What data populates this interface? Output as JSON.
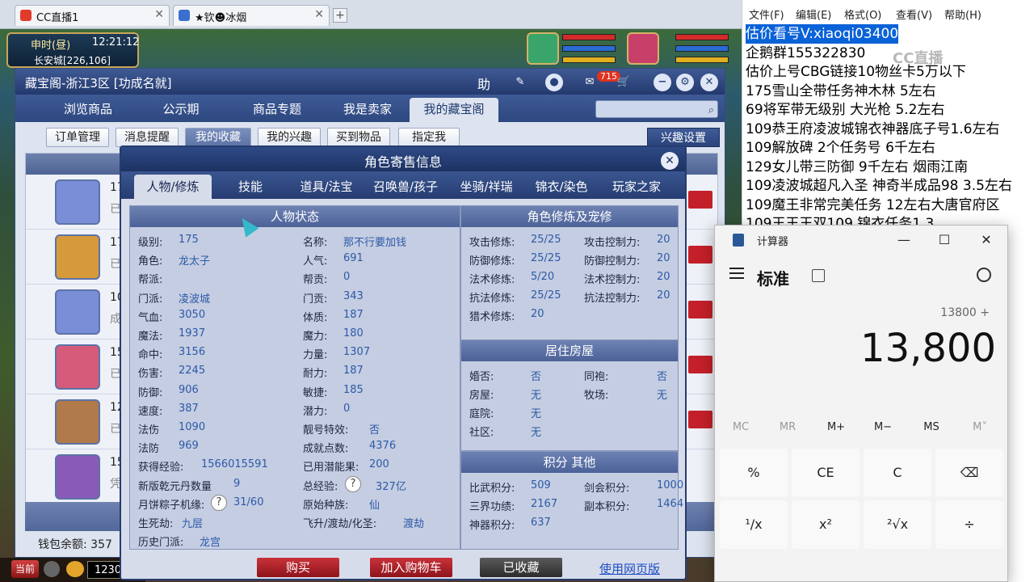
{
  "browser": {
    "tabs": [
      {
        "label": "CC直播1"
      },
      {
        "label": "★钦☻冰烟"
      }
    ],
    "add_tab": "+"
  },
  "game": {
    "time_label": "申时(昼)",
    "time_value": "12:21:12",
    "location": "长安城[226,106]",
    "bottom_left_label": "当前",
    "bottom_number": "1230",
    "colors": {
      "hp": "#d42a2a",
      "mp": "#2a6bd4",
      "sp": "#e0b020"
    }
  },
  "cbg": {
    "title": "藏宝阁-浙江3区 [功成名就]",
    "help_label": "助",
    "cart_count": "715",
    "nav_tabs": [
      "浏览商品",
      "公示期",
      "商品专题",
      "我是卖家",
      "我的藏宝阁"
    ],
    "sub_tabs": [
      "订单管理",
      "消息提醒",
      "我的收藏",
      "我的兴趣",
      "买到物品",
      "指定我"
    ],
    "interest_button": "兴趣设置",
    "list_rows": [
      {
        "level": "17",
        "sub": "已"
      },
      {
        "level": "17",
        "sub": "已"
      },
      {
        "level": "10",
        "sub": "成"
      },
      {
        "level": "15",
        "sub": "已"
      },
      {
        "level": "12",
        "sub": "已"
      },
      {
        "level": "15",
        "sub": "凭"
      }
    ],
    "wallet_label": "钱包余额: 357",
    "accent_color": "#2e4880"
  },
  "modal": {
    "title": "角色寄售信息",
    "close_label": "✕",
    "tabs": [
      "人物/修炼",
      "技能",
      "道具/法宝",
      "召唤兽/孩子",
      "坐骑/祥瑞",
      "锦衣/染色",
      "玩家之家"
    ],
    "status_panel": {
      "title": "人物状态",
      "left": [
        {
          "label": "级别:",
          "value": "175"
        },
        {
          "label": "角色:",
          "value": "龙太子"
        },
        {
          "label": "帮派:",
          "value": ""
        },
        {
          "label": "门派:",
          "value": "凌波城"
        },
        {
          "label": "气血:",
          "value": "3050"
        },
        {
          "label": "魔法:",
          "value": "1937"
        },
        {
          "label": "命中:",
          "value": "3156"
        },
        {
          "label": "伤害:",
          "value": "2245"
        },
        {
          "label": "防御:",
          "value": "906"
        },
        {
          "label": "速度:",
          "value": "387"
        },
        {
          "label": "法伤",
          "value": "1090"
        },
        {
          "label": "法防",
          "value": "969"
        },
        {
          "label": "获得经验:",
          "value": "1566015591"
        },
        {
          "label": "新版乾元丹数量",
          "value": "9"
        },
        {
          "label": "月饼粽子机缘:",
          "value": "31/60"
        },
        {
          "label": "生死劫:",
          "value": "九层"
        },
        {
          "label": "历史门派:",
          "value": "龙宫"
        }
      ],
      "right": [
        {
          "label": "名称:",
          "value": "那不行要加钱"
        },
        {
          "label": "人气:",
          "value": "691"
        },
        {
          "label": "帮贡:",
          "value": "0"
        },
        {
          "label": "门贡:",
          "value": "343"
        },
        {
          "label": "体质:",
          "value": "187"
        },
        {
          "label": "魔力:",
          "value": "180"
        },
        {
          "label": "力量:",
          "value": "1307"
        },
        {
          "label": "耐力:",
          "value": "187"
        },
        {
          "label": "敏捷:",
          "value": "185"
        },
        {
          "label": "潜力:",
          "value": "0"
        },
        {
          "label": "靓号特效:",
          "value": "否"
        },
        {
          "label": "成就点数:",
          "value": "4376"
        },
        {
          "label": "已用潜能果:",
          "value": "200"
        },
        {
          "label": "总经验:",
          "value": "327亿"
        },
        {
          "label": "原始种族:",
          "value": "仙"
        },
        {
          "label": "飞升/渡劫/化圣:",
          "value": "渡劫"
        }
      ]
    },
    "cultivation_panel": {
      "title": "角色修炼及宠修",
      "rows": [
        {
          "l1": "攻击修炼:",
          "v1": "25/25",
          "l2": "攻击控制力:",
          "v2": "20"
        },
        {
          "l1": "防御修炼:",
          "v1": "25/25",
          "l2": "防御控制力:",
          "v2": "20"
        },
        {
          "l1": "法术修炼:",
          "v1": "5/20",
          "l2": "法术控制力:",
          "v2": "20"
        },
        {
          "l1": "抗法修炼:",
          "v1": "25/25",
          "l2": "抗法控制力:",
          "v2": "20"
        },
        {
          "l1": "猎术修炼:",
          "v1": "20",
          "l2": "",
          "v2": ""
        }
      ]
    },
    "house_panel": {
      "title": "居住房屋",
      "rows": [
        {
          "l1": "婚否:",
          "v1": "否",
          "l2": "同袍:",
          "v2": "否"
        },
        {
          "l1": "房屋:",
          "v1": "无",
          "l2": "牧场:",
          "v2": "无"
        },
        {
          "l1": "庭院:",
          "v1": "无",
          "l2": "",
          "v2": ""
        },
        {
          "l1": "社区:",
          "v1": "无",
          "l2": "",
          "v2": ""
        }
      ]
    },
    "points_panel": {
      "title": "积分 其他",
      "rows": [
        {
          "l1": "比武积分:",
          "v1": "509",
          "l2": "剑会积分:",
          "v2": "1000"
        },
        {
          "l1": "三界功绩:",
          "v1": "2167",
          "l2": "副本积分:",
          "v2": "1464"
        },
        {
          "l1": "神器积分:",
          "v1": "637",
          "l2": "",
          "v2": ""
        }
      ]
    },
    "qmark": "?",
    "buttons": {
      "buy": "购买",
      "add_cart": "加入购物车",
      "favorited": "已收藏",
      "web": "使用网页版"
    }
  },
  "notepad": {
    "menu": [
      "文件(F)",
      "编辑(E)",
      "格式(O)",
      "查看(V)",
      "帮助(H)"
    ],
    "watermark": "CC直播",
    "lines": [
      "估价看号V:xiaoqi03400",
      "企鹅群155322830",
      "估价上号CBG链接10物丝卡5万以下",
      "175雪山全带任务神木林 5左右",
      "69将军带无级别 大光枪 5.2左右",
      "109恭王府凌波城锦衣神器底子号1.6左右",
      "109解放碑 2个任务号 6千左右",
      "129女儿带三防御 9千左右 烟雨江南",
      "109凌波城超凡入圣 神奇半成品98 3.5左右",
      "109魔王非常完美任务 12左右大唐官府区",
      "109王王王双109  锦衣任务1.3"
    ]
  },
  "calculator": {
    "title": "计算器",
    "mode": "标准",
    "expression": "13800 +",
    "display": "13,800",
    "memory_buttons": [
      "MC",
      "MR",
      "M+",
      "M−",
      "MS",
      "M˅"
    ],
    "keys": [
      "%",
      "CE",
      "C",
      "⌫",
      "¹/x",
      "x²",
      "²√x",
      "÷"
    ],
    "window_controls": {
      "minimize": "—",
      "maximize": "☐",
      "close": "✕"
    }
  }
}
